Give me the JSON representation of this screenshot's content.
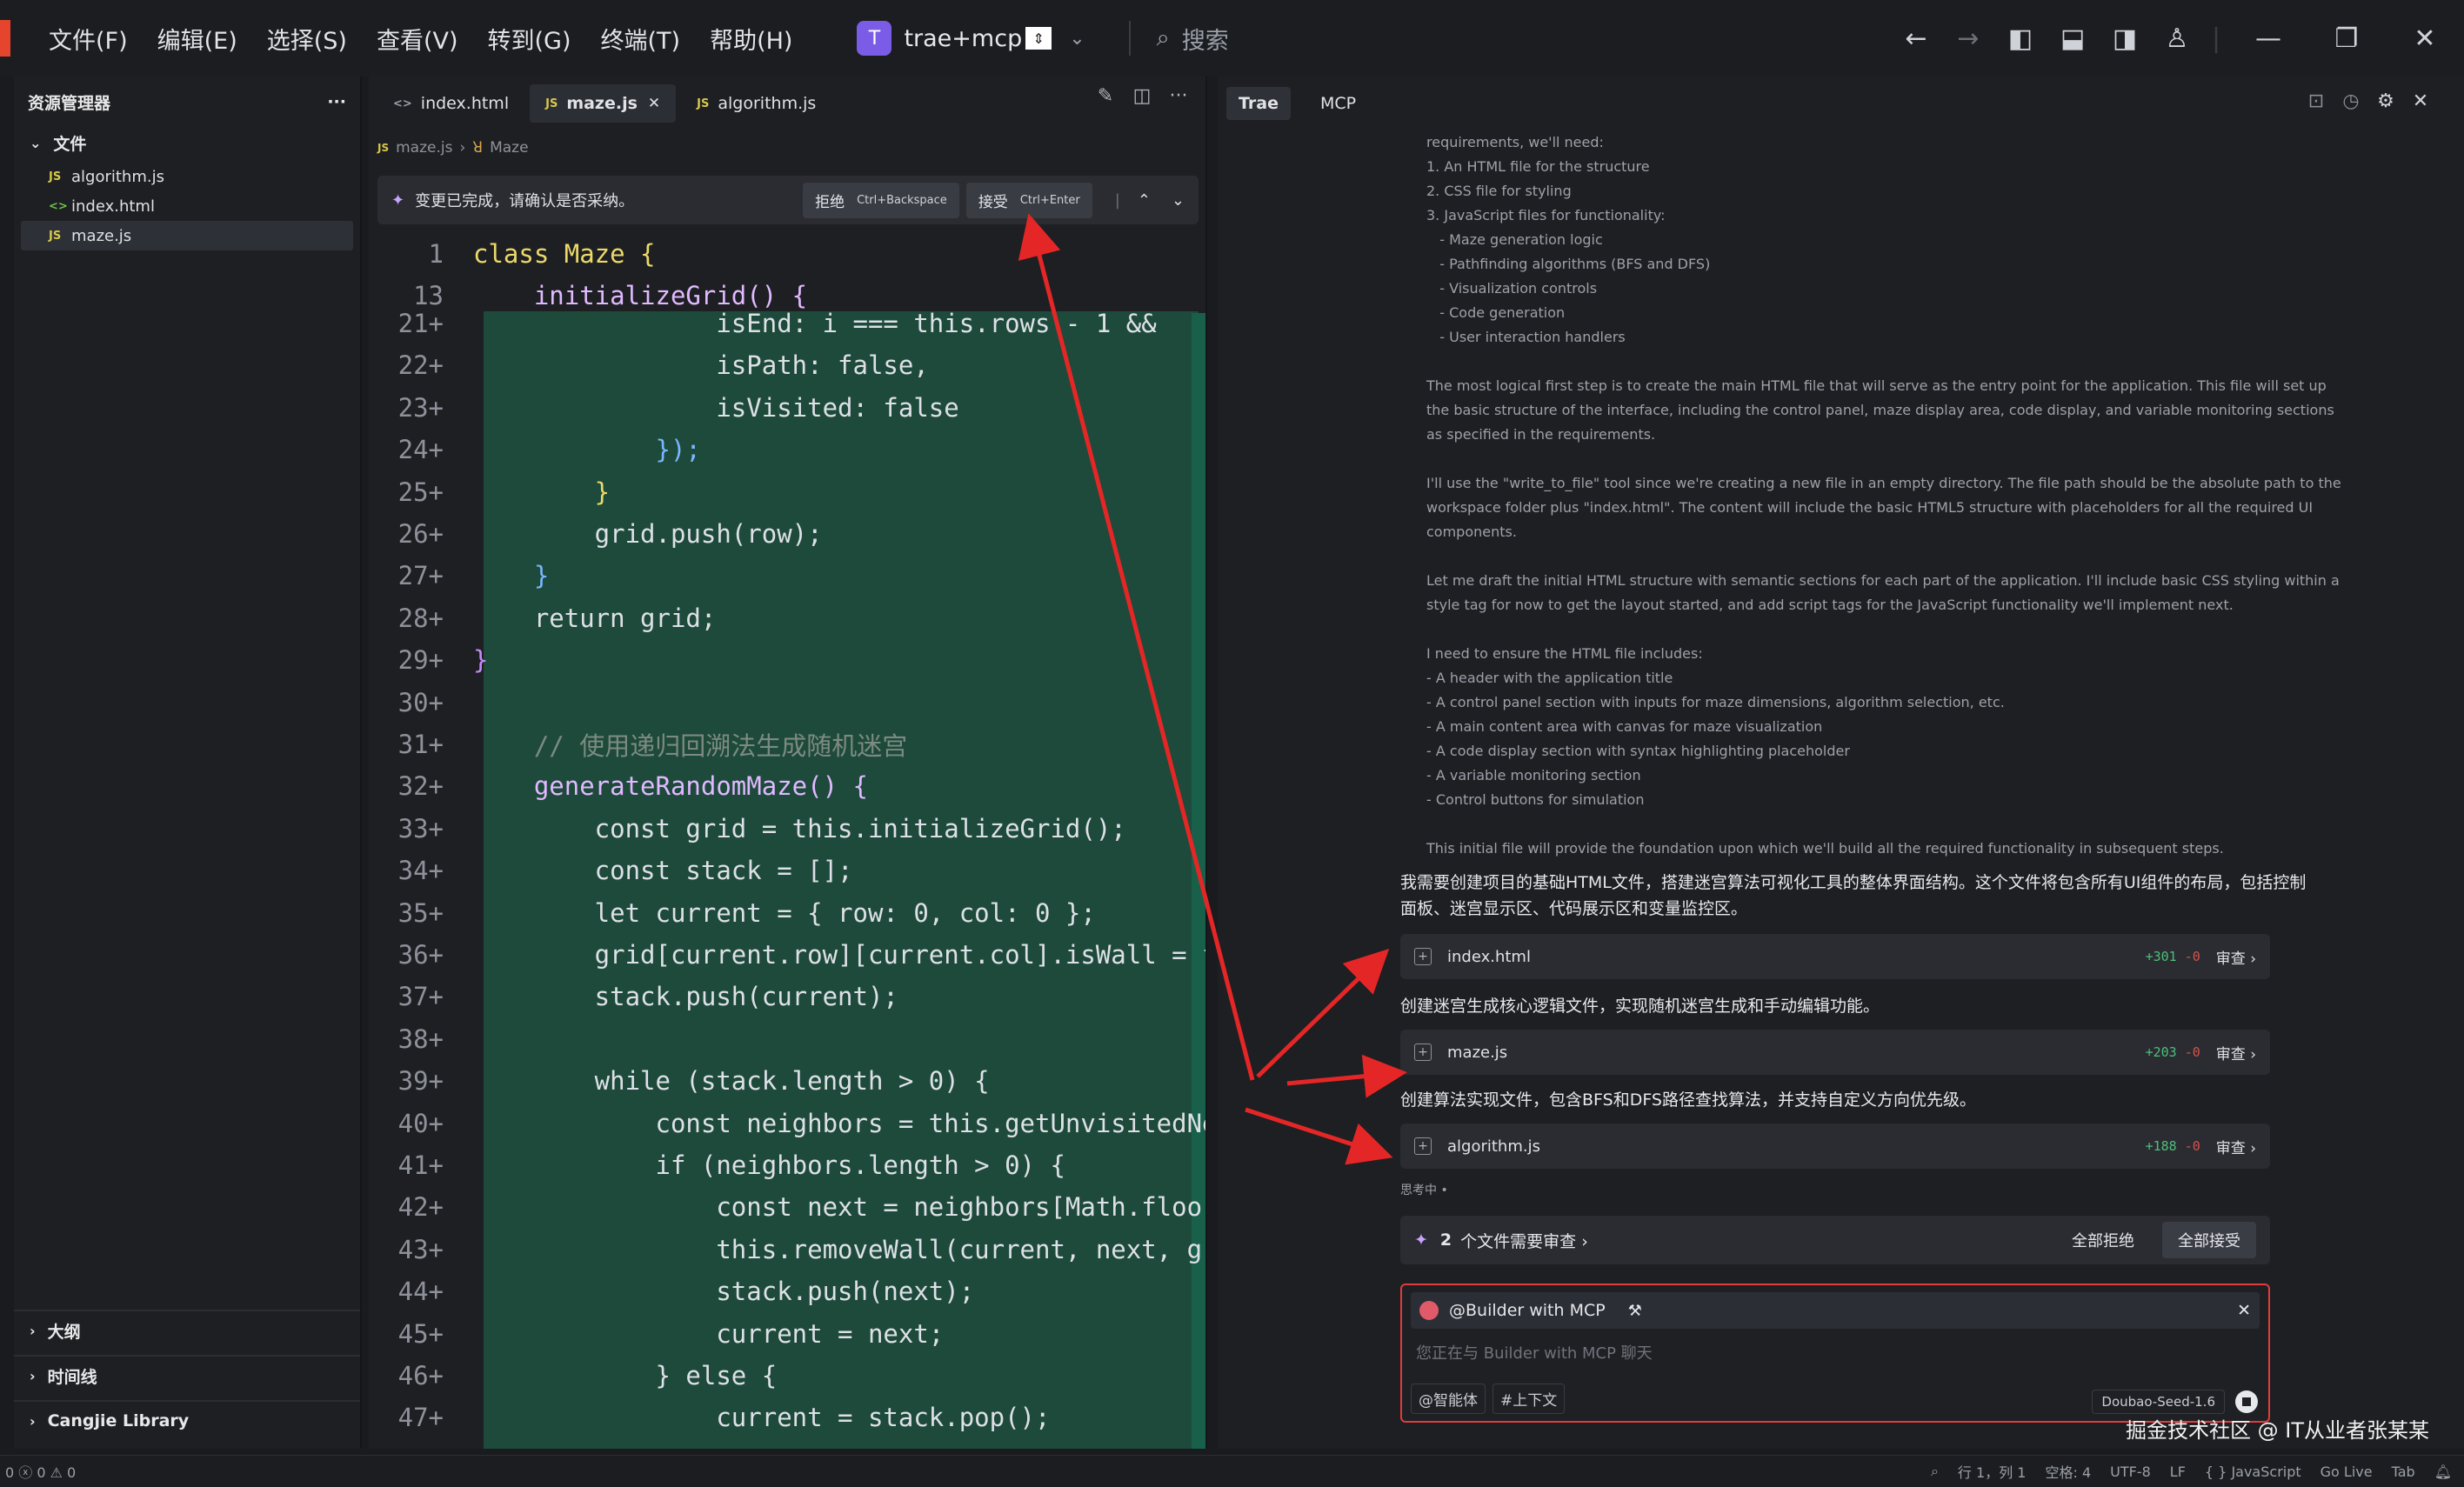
{
  "menu": [
    "文件(F)",
    "编辑(E)",
    "选择(S)",
    "查看(V)",
    "转到(G)",
    "终端(T)",
    "帮助(H)"
  ],
  "project": {
    "avatar": "T",
    "name": "trae+mcp"
  },
  "search": {
    "label": "搜索"
  },
  "explorer": {
    "title": "资源管理器",
    "more": "···",
    "section": "文件",
    "files": [
      {
        "icon": "JS",
        "name": "algorithm.js"
      },
      {
        "icon": "<>",
        "name": "index.html"
      },
      {
        "icon": "JS",
        "name": "maze.js"
      }
    ],
    "bottom_sections": [
      "大纲",
      "时间线",
      "Cangjie Library"
    ]
  },
  "editor": {
    "tabs": [
      {
        "icon": "<>",
        "name": "index.html"
      },
      {
        "icon": "JS",
        "name": "maze.js"
      },
      {
        "icon": "JS",
        "name": "algorithm.js"
      }
    ],
    "breadcrumb": {
      "file": "maze.js",
      "symbol": "Maze"
    },
    "diff": {
      "message": "变更已完成，请确认是否采纳。",
      "reject": "拒绝",
      "reject_key": "Ctrl+Backspace",
      "accept": "接受",
      "accept_key": "Ctrl+Enter"
    },
    "lines": [
      {
        "n": "1",
        "t": "class Maze {",
        "c": "#ecd96a"
      },
      {
        "n": "13",
        "t": "    initializeGrid() {",
        "c": "#e0b9ff"
      },
      {
        "n": "21+",
        "t": "                isEnd: i === this.rows - 1 &&",
        "c": "#dde0e6"
      },
      {
        "n": "22+",
        "t": "                isPath: false,",
        "c": "#dde0e6"
      },
      {
        "n": "23+",
        "t": "                isVisited: false",
        "c": "#dde0e6"
      },
      {
        "n": "24+",
        "t": "            });",
        "c": "#7ab6ff"
      },
      {
        "n": "25+",
        "t": "        }",
        "c": "#ecd96a"
      },
      {
        "n": "26+",
        "t": "        grid.push(row);",
        "c": "#dde0e6"
      },
      {
        "n": "27+",
        "t": "    }",
        "c": "#7ab6ff"
      },
      {
        "n": "28+",
        "t": "    return grid;",
        "c": "#dde0e6"
      },
      {
        "n": "29+",
        "t": "}",
        "c": "#c58af9"
      },
      {
        "n": "30+",
        "t": "",
        "c": "#dde0e6"
      },
      {
        "n": "31+",
        "t": "    // 使用递归回溯法生成随机迷宫",
        "c": "#7d8a84"
      },
      {
        "n": "32+",
        "t": "    generateRandomMaze() {",
        "c": "#e0b9ff"
      },
      {
        "n": "33+",
        "t": "        const grid = this.initializeGrid();",
        "c": "#dde0e6"
      },
      {
        "n": "34+",
        "t": "        const stack = [];",
        "c": "#dde0e6"
      },
      {
        "n": "35+",
        "t": "        let current = { row: 0, col: 0 };",
        "c": "#dde0e6"
      },
      {
        "n": "36+",
        "t": "        grid[current.row][current.col].isWall = fa",
        "c": "#dde0e6"
      },
      {
        "n": "37+",
        "t": "        stack.push(current);",
        "c": "#dde0e6"
      },
      {
        "n": "38+",
        "t": "",
        "c": "#dde0e6"
      },
      {
        "n": "39+",
        "t": "        while (stack.length > 0) {",
        "c": "#dde0e6"
      },
      {
        "n": "40+",
        "t": "            const neighbors = this.getUnvisitedNei",
        "c": "#dde0e6"
      },
      {
        "n": "41+",
        "t": "            if (neighbors.length > 0) {",
        "c": "#dde0e6"
      },
      {
        "n": "42+",
        "t": "                const next = neighbors[Math.floor(",
        "c": "#dde0e6"
      },
      {
        "n": "43+",
        "t": "                this.removeWall(current, next, gri",
        "c": "#dde0e6"
      },
      {
        "n": "44+",
        "t": "                stack.push(next);",
        "c": "#dde0e6"
      },
      {
        "n": "45+",
        "t": "                current = next;",
        "c": "#dde0e6"
      },
      {
        "n": "46+",
        "t": "            } else {",
        "c": "#dde0e6"
      },
      {
        "n": "47+",
        "t": "                current = stack.pop();",
        "c": "#dde0e6"
      }
    ]
  },
  "chat": {
    "tabs": [
      "Trae",
      "MCP"
    ],
    "thinking": [
      "requirements, we'll need:",
      "1. An HTML file for the structure",
      "2. CSS file for styling",
      "3. JavaScript files for functionality:",
      "   - Maze generation logic",
      "   - Pathfinding algorithms (BFS and DFS)",
      "   - Visualization controls",
      "   - Code generation",
      "   - User interaction handlers",
      "",
      "The most logical first step is to create the main HTML file that will serve as the entry point for the application. This file will set up",
      "the basic structure of the interface, including the control panel, maze display area, code display, and variable monitoring sections",
      "as specified in the requirements.",
      "",
      "I'll use the \"write_to_file\" tool since we're creating a new file in an empty directory. The file path should be the absolute path to the",
      "workspace folder plus \"index.html\". The content will include the basic HTML5 structure with placeholders for all the required UI",
      "components.",
      "",
      "Let me draft the initial HTML structure with semantic sections for each part of the application. I'll include basic CSS styling within a",
      "style tag for now to get the layout started, and add script tags for the JavaScript functionality we'll implement next.",
      "",
      "I need to ensure the HTML file includes:",
      "- A header with the application title",
      "- A control panel section with inputs for maze dimensions, algorithm selection, etc.",
      "- A main content area with canvas for maze visualization",
      "- A code display section with syntax highlighting placeholder",
      "- A variable monitoring section",
      "- Control buttons for simulation",
      "",
      "This initial file will provide the foundation upon which we'll build all the required functionality in subsequent steps."
    ],
    "msg1": "我需要创建项目的基础HTML文件，搭建迷宫算法可视化工具的整体界面结构。这个文件将包含所有UI组件的布局，包括控制",
    "msg1b": "面板、迷宫显示区、代码展示区和变量监控区。",
    "file1": {
      "name": "index.html",
      "add": "+301",
      "del": "-0",
      "review": "审查 ›"
    },
    "msg2": "创建迷宫生成核心逻辑文件，实现随机迷宫生成和手动编辑功能。",
    "file2": {
      "name": "maze.js",
      "add": "+203",
      "del": "-0",
      "review": "审查 ›"
    },
    "msg3": "创建算法实现文件，包含BFS和DFS路径查找算法，并支持自定义方向优先级。",
    "file3": {
      "name": "algorithm.js",
      "add": "+188",
      "del": "-0",
      "review": "审查 ›"
    },
    "status": "思考中 •",
    "review_bar": {
      "count": "2",
      "label": "个文件需要审查 ›",
      "reject_all": "全部拒绝",
      "accept_all": "全部接受"
    },
    "input": {
      "agent": "@Builder with MCP",
      "placeholder": "您正在与 Builder with MCP 聊天",
      "chip1": "@智能体",
      "chip2": "#上下文",
      "model": "Doubao-Seed-1.6"
    },
    "watermark": "掘金技术社区 @ IT从业者张某某"
  },
  "statusbar": {
    "left": "0 ⓧ 0 ⚠ 0",
    "items": [
      "行 1，列 1",
      "空格: 4",
      "UTF-8",
      "LF",
      "{ } JavaScript",
      "Go Live",
      "Tab"
    ]
  },
  "colors": {
    "annotation_arrow": "#e52626",
    "added_line_bg": "#1d4a3a",
    "accent": "#7a5ce6"
  }
}
